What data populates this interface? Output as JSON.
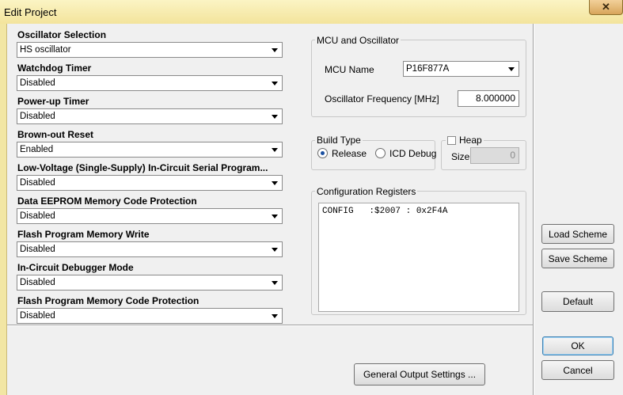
{
  "window": {
    "title": "Edit Project",
    "close_glyph": "✕"
  },
  "config_options": [
    {
      "label": "Oscillator Selection",
      "value": "HS oscillator"
    },
    {
      "label": "Watchdog Timer",
      "value": "Disabled"
    },
    {
      "label": "Power-up Timer",
      "value": "Disabled"
    },
    {
      "label": "Brown-out Reset",
      "value": "Enabled"
    },
    {
      "label": "Low-Voltage (Single-Supply) In-Circuit Serial Program...",
      "value": "Disabled"
    },
    {
      "label": "Data EEPROM Memory Code Protection",
      "value": "Disabled"
    },
    {
      "label": "Flash Program Memory Write",
      "value": "Disabled"
    },
    {
      "label": "In-Circuit Debugger Mode",
      "value": "Disabled"
    },
    {
      "label": "Flash Program Memory Code Protection",
      "value": "Disabled"
    }
  ],
  "mcu_group": {
    "title": "MCU and Oscillator",
    "mcu_name_label": "MCU Name",
    "mcu_name_value": "P16F877A",
    "osc_freq_label": "Oscillator Frequency [MHz]",
    "osc_freq_value": "8.000000"
  },
  "build_type": {
    "title": "Build Type",
    "release_label": "Release",
    "icd_label": "ICD Debug",
    "selected": "Release"
  },
  "heap": {
    "label": "Heap",
    "checked": false,
    "size_label": "Size",
    "size_value": "0"
  },
  "config_registers": {
    "title": "Configuration Registers",
    "content": "CONFIG   :$2007 : 0x2F4A"
  },
  "buttons": {
    "load_scheme": "Load Scheme",
    "save_scheme": "Save Scheme",
    "default": "Default",
    "ok": "OK",
    "cancel": "Cancel",
    "general_output": "General Output Settings ..."
  }
}
